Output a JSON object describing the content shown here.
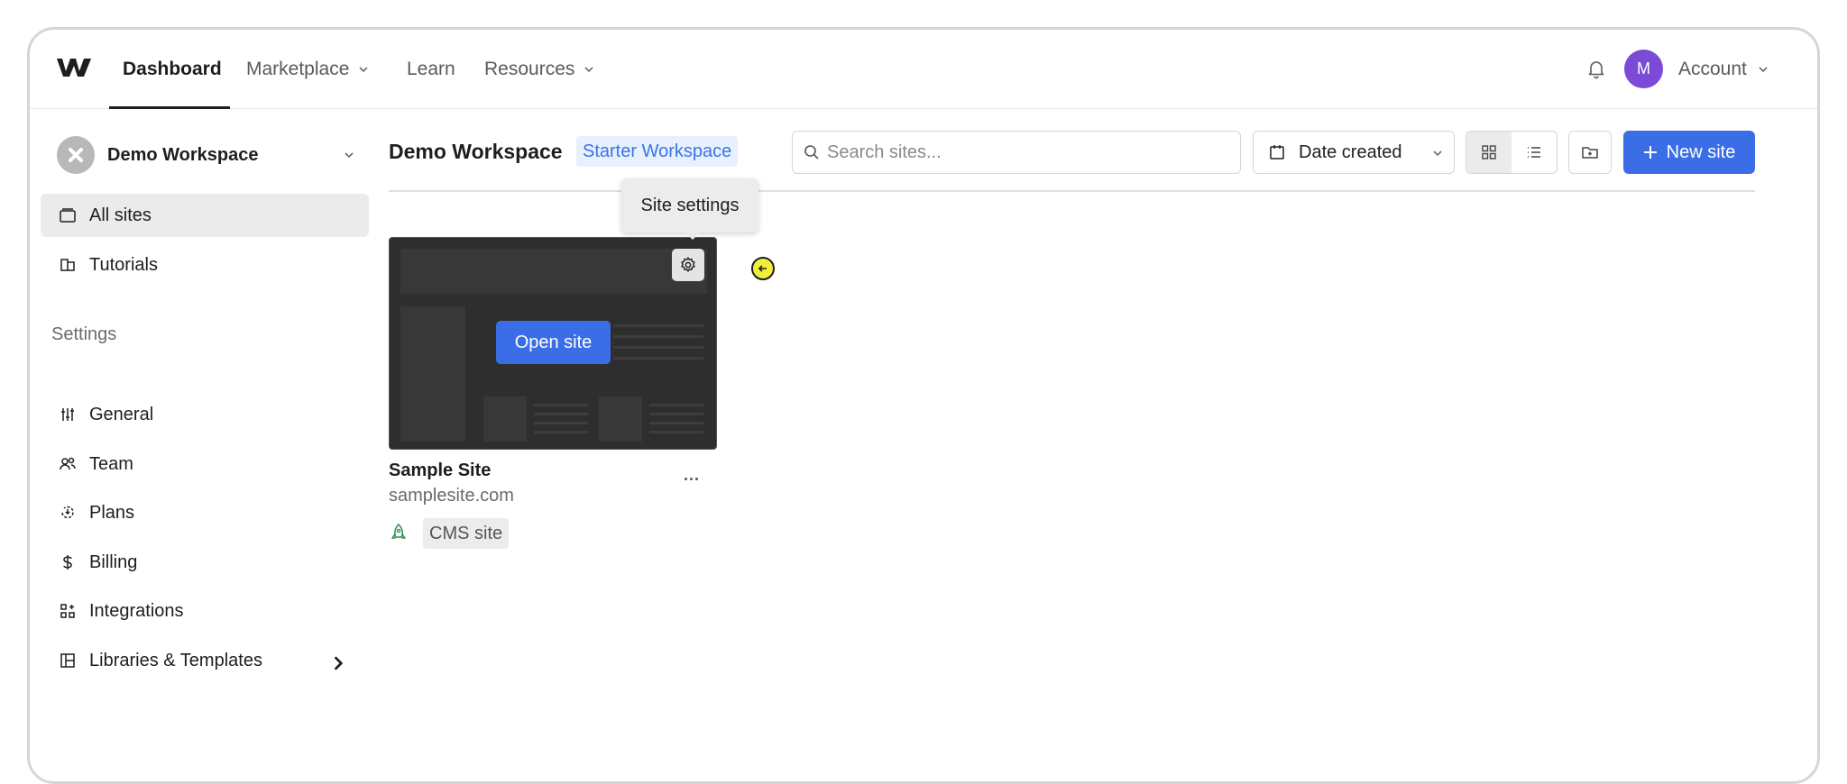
{
  "nav": {
    "items": [
      {
        "label": "Dashboard"
      },
      {
        "label": "Marketplace"
      },
      {
        "label": "Learn"
      },
      {
        "label": "Resources"
      }
    ],
    "avatar_initial": "M",
    "account_label": "Account"
  },
  "sidebar": {
    "workspace_name": "Demo Workspace",
    "items": [
      {
        "label": "All sites",
        "icon": "folder-icon"
      },
      {
        "label": "Tutorials",
        "icon": "tutorial-icon"
      }
    ],
    "settings_heading": "Settings",
    "settings_items": [
      {
        "label": "General",
        "icon": "sliders-icon"
      },
      {
        "label": "Team",
        "icon": "team-icon"
      },
      {
        "label": "Plans",
        "icon": "plans-icon"
      },
      {
        "label": "Billing",
        "icon": "dollar-icon"
      },
      {
        "label": "Integrations",
        "icon": "integrations-icon"
      },
      {
        "label": "Libraries & Templates",
        "icon": "library-icon"
      }
    ]
  },
  "main": {
    "title": "Demo Workspace",
    "plan_badge": "Starter Workspace",
    "search_placeholder": "Search sites...",
    "sort_label": "Date created",
    "new_site_label": "New site",
    "tooltip": "Site settings"
  },
  "site": {
    "open_label": "Open site",
    "name": "Sample Site",
    "url": "samplesite.com",
    "badge": "CMS site"
  },
  "colors": {
    "accent": "#3b6ee6",
    "avatar": "#7b4ad7",
    "badge_bg": "#e7f0fd"
  }
}
